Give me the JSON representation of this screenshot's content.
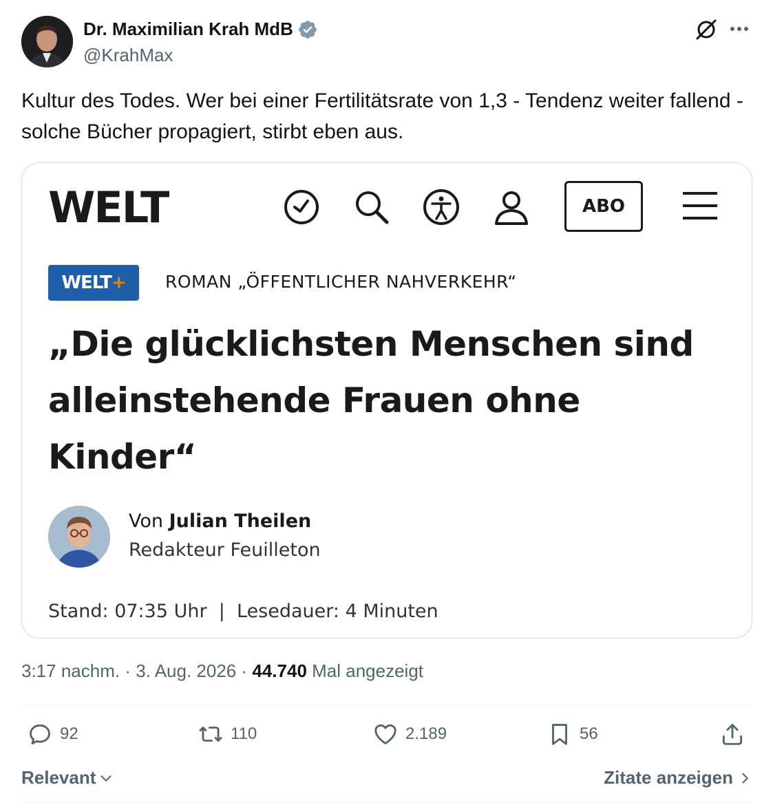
{
  "author": {
    "name": "Dr. Maximilian Krah MdB",
    "handle": "@KrahMax"
  },
  "tweet": {
    "text": "Kultur des Todes. Wer bei einer Fertilitätsrate von 1,3 - Tendenz weiter fallend - solche Bücher propagiert, stirbt eben aus."
  },
  "card": {
    "logo": "WELT",
    "abo_label": "ABO",
    "badge_main": "WELT",
    "badge_plus": "+",
    "kicker": "ROMAN „ÖFFENTLICHER NAHVERKEHR“",
    "headline": "„Die glücklichsten Menschen sind alleinstehende Frauen ohne Kinder“",
    "byline_prefix": "Von",
    "author_name": "Julian Theilen",
    "author_role": "Redakteur Feuilleton",
    "meta": "Stand: 07:35 Uhr  |  Lesedauer: 4 Minuten"
  },
  "timestamp": {
    "time": "3:17 nachm.",
    "date": "3. Aug. 2026",
    "views_count": "44.740",
    "views_label": "Mal angezeigt"
  },
  "actions": {
    "replies": "92",
    "reposts": "110",
    "likes": "2.189",
    "bookmarks": "56"
  },
  "footer": {
    "sort_label": "Relevant",
    "quotes_label": "Zitate anzeigen"
  },
  "colors": {
    "verified": "#829aab",
    "secondary_text": "#536471",
    "welt_blue": "#1f5ea8",
    "welt_orange": "#f07d00"
  }
}
